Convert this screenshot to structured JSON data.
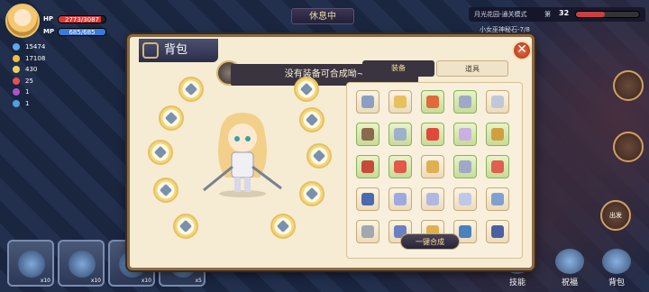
{
  "player": {
    "hp_label": "HP",
    "hp_value": "2773/3087",
    "hp_fraction": 0.9,
    "mp_label": "MP",
    "mp_value": "685/685",
    "mp_fraction": 1.0,
    "stats": [
      {
        "value": "15474",
        "color": "#5aa8f0"
      },
      {
        "value": "17108",
        "color": "#f0c040"
      },
      {
        "value": "430",
        "color": "#f0d060"
      },
      {
        "value": "25",
        "color": "#e85050"
      },
      {
        "value": "1",
        "color": "#b050d0"
      },
      {
        "value": "1",
        "color": "#50a0e0"
      }
    ]
  },
  "hud": {
    "rest_tag": "休息中",
    "mode_text": "月光花园-通关模式",
    "level_prefix": "第",
    "level_number": "32",
    "level_progress": 0.45,
    "quest_text": "小女巫神秘石-7/8"
  },
  "right_buttons": {
    "depart_label": "出发"
  },
  "bottom": {
    "slots": [
      {
        "level": "x10"
      },
      {
        "level": "x10"
      },
      {
        "level": "x10"
      },
      {
        "level": "x5"
      }
    ],
    "skill_label": "技能",
    "bless_label": "祝福",
    "bag_label": "背包"
  },
  "panel": {
    "title": "背包",
    "notice": "没有装备可合成呦~",
    "tabs": {
      "equipment": "装备",
      "items": "道具"
    },
    "merge_button": "一键合成",
    "grid_colors": [
      [
        "#8aa0c0",
        "#e8c060",
        "#e06a3a",
        "#a0a8c8",
        "#c0c8d8"
      ],
      [
        "#8a6a4a",
        "#a0b0c8",
        "#e04a3a",
        "#c8b0e0",
        "#d0a040"
      ],
      [
        "#c84a3a",
        "#e05a4a",
        "#e0b050",
        "#a0a8c8",
        "#e06050"
      ],
      [
        "#4a6ab0",
        "#a0a8e0",
        "#b0b8e0",
        "#c0c8e8",
        "#80a0d0"
      ],
      [
        "#a0a8b0",
        "#6a80c0",
        "#e0b050",
        "#4a80c0",
        "#4a60a0"
      ]
    ],
    "green_cells": [
      [
        0,
        2
      ],
      [
        0,
        3
      ],
      [
        1,
        0
      ],
      [
        1,
        1
      ],
      [
        1,
        2
      ],
      [
        1,
        3
      ],
      [
        1,
        4
      ],
      [
        2,
        0
      ],
      [
        2,
        1
      ],
      [
        2,
        3
      ],
      [
        2,
        4
      ]
    ]
  }
}
